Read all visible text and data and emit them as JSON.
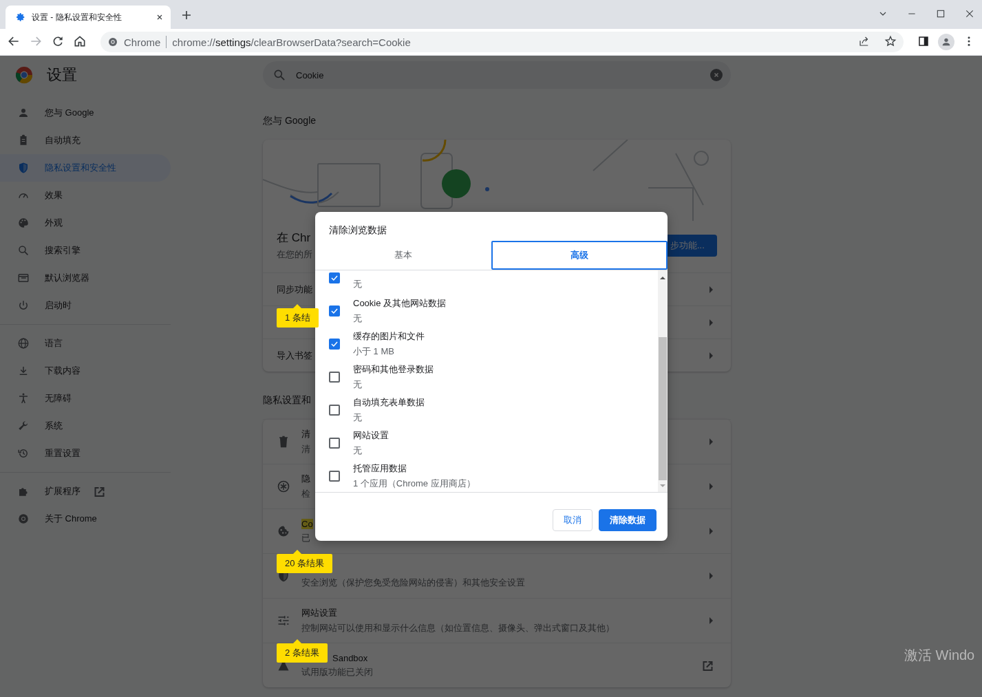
{
  "browser": {
    "tabs": [
      {
        "title": "设置 - 隐私设置和安全性",
        "selected": true
      }
    ],
    "forward_disabled": true,
    "address": {
      "site_label": "Chrome",
      "url_scheme": "chrome://",
      "url_host": "settings",
      "url_path": "/clearBrowserData?search=Cookie"
    }
  },
  "header": {
    "title": "设置",
    "search": {
      "value": "Cookie"
    }
  },
  "sidebar": {
    "groups": [
      [
        {
          "label": "您与 Google",
          "selected": false
        },
        {
          "label": "自动填充",
          "selected": false
        },
        {
          "label": "隐私设置和安全性",
          "selected": true
        },
        {
          "label": "效果",
          "selected": false
        },
        {
          "label": "外观",
          "selected": false
        },
        {
          "label": "搜索引擎",
          "selected": false
        },
        {
          "label": "默认浏览器",
          "selected": false
        },
        {
          "label": "启动时",
          "selected": false
        }
      ],
      [
        {
          "label": "语言",
          "selected": false
        },
        {
          "label": "下载内容",
          "selected": false
        },
        {
          "label": "无障碍",
          "selected": false
        },
        {
          "label": "系统",
          "selected": false
        },
        {
          "label": "重置设置",
          "selected": false
        }
      ],
      [
        {
          "label": "扩展程序",
          "selected": false,
          "external": true
        },
        {
          "label": "关于 Chrome",
          "selected": false,
          "external": false
        }
      ]
    ]
  },
  "sections": [
    {
      "title": "您与 Google",
      "promo": {
        "heading": "在 Chr",
        "subtitle": "在您的所",
        "button": "步功能..."
      },
      "rows": [
        {
          "title": "同步功能"
        },
        {
          "badge": "1 条结"
        },
        {
          "title": "导入书签"
        }
      ]
    },
    {
      "title": "隐私设置和",
      "rows": [
        {
          "title": "清",
          "subtitle": "清"
        },
        {
          "title": "隐",
          "subtitle": "检"
        },
        {
          "title": "Co",
          "subtitle": "已",
          "highlighted": true
        },
        {
          "badge": "20 条结果",
          "subtitle": "安全浏览（保护您免受危险网站的侵害）和其他安全设置"
        },
        {
          "title": "网站设置",
          "subtitle": "控制网站可以使用和显示什么信息（如位置信息、摄像头、弹出式窗口及其他）"
        },
        {
          "badge": "2 条结果",
          "title": "Sandbox",
          "subtitle": "试用版功能已关闭",
          "external": true
        }
      ]
    }
  ],
  "dialog": {
    "title": "清除浏览数据",
    "tabs": [
      {
        "label": "基本",
        "selected": false
      },
      {
        "label": "高级",
        "selected": true
      }
    ],
    "items": [
      {
        "detail": "无",
        "checked": true
      },
      {
        "label": "Cookie 及其他网站数据",
        "detail": "无",
        "checked": true
      },
      {
        "label": "缓存的图片和文件",
        "detail": "小于 1 MB",
        "checked": true
      },
      {
        "label": "密码和其他登录数据",
        "detail": "无",
        "checked": false
      },
      {
        "label": "自动填充表单数据",
        "detail": "无",
        "checked": false
      },
      {
        "label": "网站设置",
        "detail": "无",
        "checked": false
      },
      {
        "label": "托管应用数据",
        "detail": "1 个应用（Chrome 应用商店）",
        "checked": false
      }
    ],
    "buttons": [
      {
        "label": "取消",
        "kind": "secondary"
      },
      {
        "label": "清除数据",
        "kind": "primary"
      }
    ]
  },
  "os_notice": {
    "text": "激活 Windo"
  }
}
